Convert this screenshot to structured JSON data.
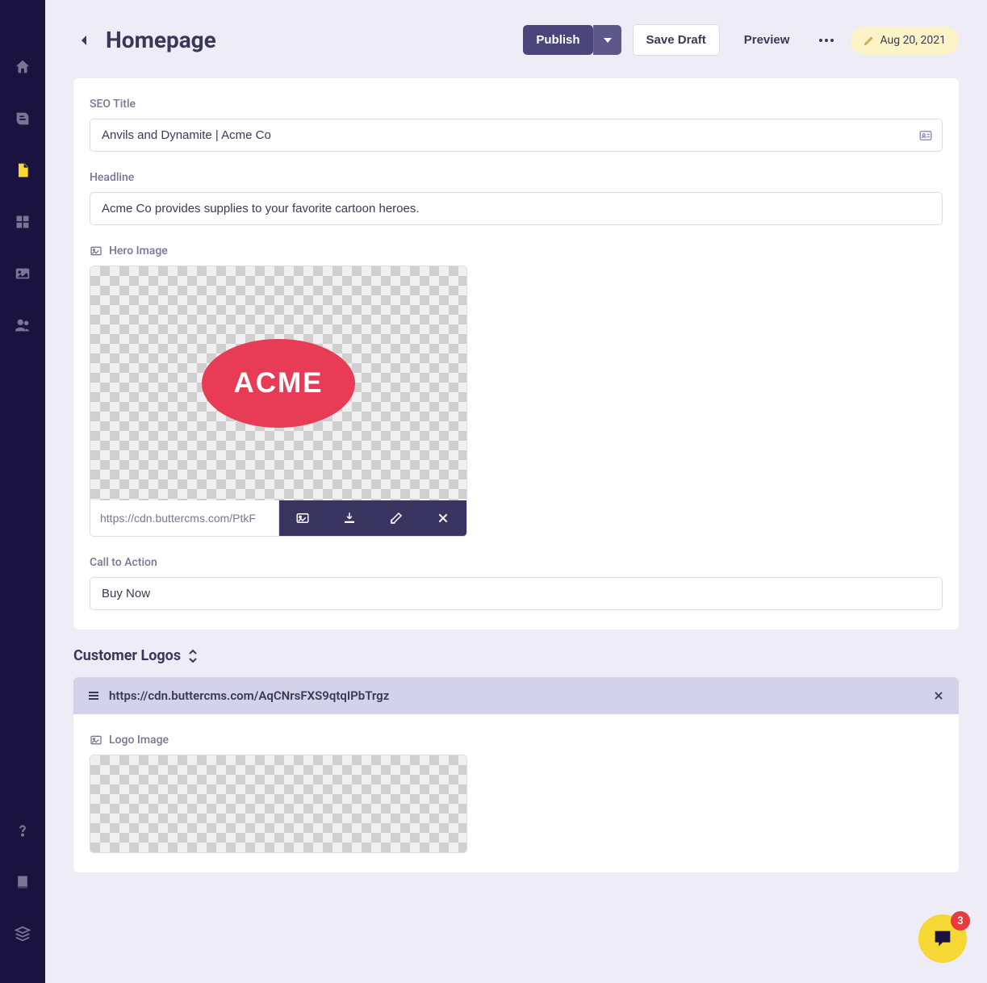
{
  "header": {
    "title": "Homepage",
    "publish_label": "Publish",
    "save_draft_label": "Save Draft",
    "preview_label": "Preview",
    "date_label": "Aug 20, 2021"
  },
  "fields": {
    "seo_title": {
      "label": "SEO Title",
      "value": "Anvils and Dynamite | Acme Co"
    },
    "headline": {
      "label": "Headline",
      "value": "Acme Co provides supplies to your favorite cartoon heroes."
    },
    "hero_image": {
      "label": "Hero Image",
      "url": "https://cdn.buttercms.com/PtkF",
      "logo_text": "ACME"
    },
    "cta": {
      "label": "Call to Action",
      "value": "Buy Now"
    }
  },
  "customer_logos": {
    "title": "Customer Logos",
    "items": [
      {
        "url": "https://cdn.buttercms.com/AqCNrsFXS9qtqIPbTrgz",
        "logo_label": "Logo Image"
      }
    ]
  },
  "chat": {
    "badge": "3"
  }
}
